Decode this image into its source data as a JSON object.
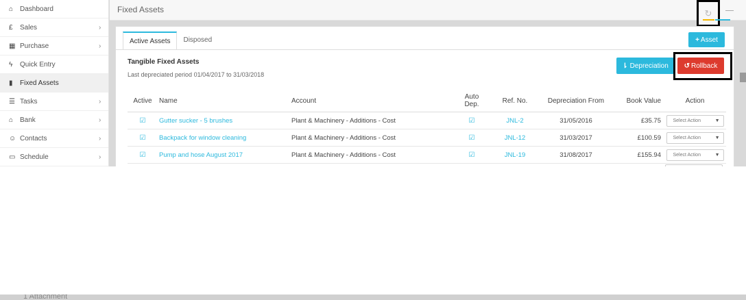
{
  "sidebar": {
    "items": [
      {
        "label": "Dashboard",
        "icon": "home-icon",
        "glyph": "⌂",
        "chevron": ""
      },
      {
        "label": "Sales",
        "icon": "pound-icon",
        "glyph": "£",
        "chevron": "›"
      },
      {
        "label": "Purchase",
        "icon": "barcode-icon",
        "glyph": "▦",
        "chevron": "›"
      },
      {
        "label": "Quick Entry",
        "icon": "bolt-icon",
        "glyph": "ϟ",
        "chevron": ""
      },
      {
        "label": "Fixed Assets",
        "icon": "book-icon",
        "glyph": "▮",
        "chevron": ""
      },
      {
        "label": "Tasks",
        "icon": "list-icon",
        "glyph": "☰",
        "chevron": "›"
      },
      {
        "label": "Bank",
        "icon": "bank-icon",
        "glyph": "⌂",
        "chevron": "›"
      },
      {
        "label": "Contacts",
        "icon": "users-icon",
        "glyph": "☺",
        "chevron": "›"
      },
      {
        "label": "Schedule",
        "icon": "calendar-icon",
        "glyph": "▭",
        "chevron": "›"
      }
    ]
  },
  "header": {
    "title": "Fixed Assets",
    "refresh_glyph": "↻"
  },
  "tabs": [
    {
      "label": "Active Assets"
    },
    {
      "label": "Disposed"
    }
  ],
  "buttons": {
    "add_asset": "Asset",
    "add_asset_glyph": "+",
    "depreciation": "Depreciation",
    "depreciation_glyph": "⇂",
    "rollback": "Rollback",
    "rollback_glyph": "↺"
  },
  "section": {
    "title": "Tangible Fixed Assets",
    "subtitle": "Last depreciated period 01/04/2017 to 31/03/2018"
  },
  "table": {
    "headers": {
      "active": "Active",
      "name": "Name",
      "account": "Account",
      "auto_dep_line1": "Auto",
      "auto_dep_line2": "Dep.",
      "ref": "Ref. No.",
      "dep_from": "Depreciation From",
      "book_value": "Book Value",
      "action": "Action"
    },
    "rows": [
      {
        "check": "☑",
        "name": "Gutter sucker - 5 brushes",
        "account": "Plant & Machinery - Additions - Cost",
        "auto": "☑",
        "ref": "JNL-2",
        "dep_from": "31/05/2016",
        "book_value": "£35.75",
        "action": "Select Action"
      },
      {
        "check": "☑",
        "name": "Backpack for window cleaning",
        "account": "Plant & Machinery - Additions - Cost",
        "auto": "☑",
        "ref": "JNL-12",
        "dep_from": "31/03/2017",
        "book_value": "£100.59",
        "action": "Select Action"
      },
      {
        "check": "☑",
        "name": "Pump and hose August 2017",
        "account": "Plant & Machinery - Additions - Cost",
        "auto": "☑",
        "ref": "JNL-19",
        "dep_from": "31/08/2017",
        "book_value": "£155.94",
        "action": "Select Action"
      }
    ],
    "caret": "▼"
  },
  "footer": {
    "attachment": "1 Attachment"
  },
  "colors": {
    "accent": "#2cb9dd",
    "danger": "#dd3b2e",
    "highlight": "#f5b800"
  }
}
